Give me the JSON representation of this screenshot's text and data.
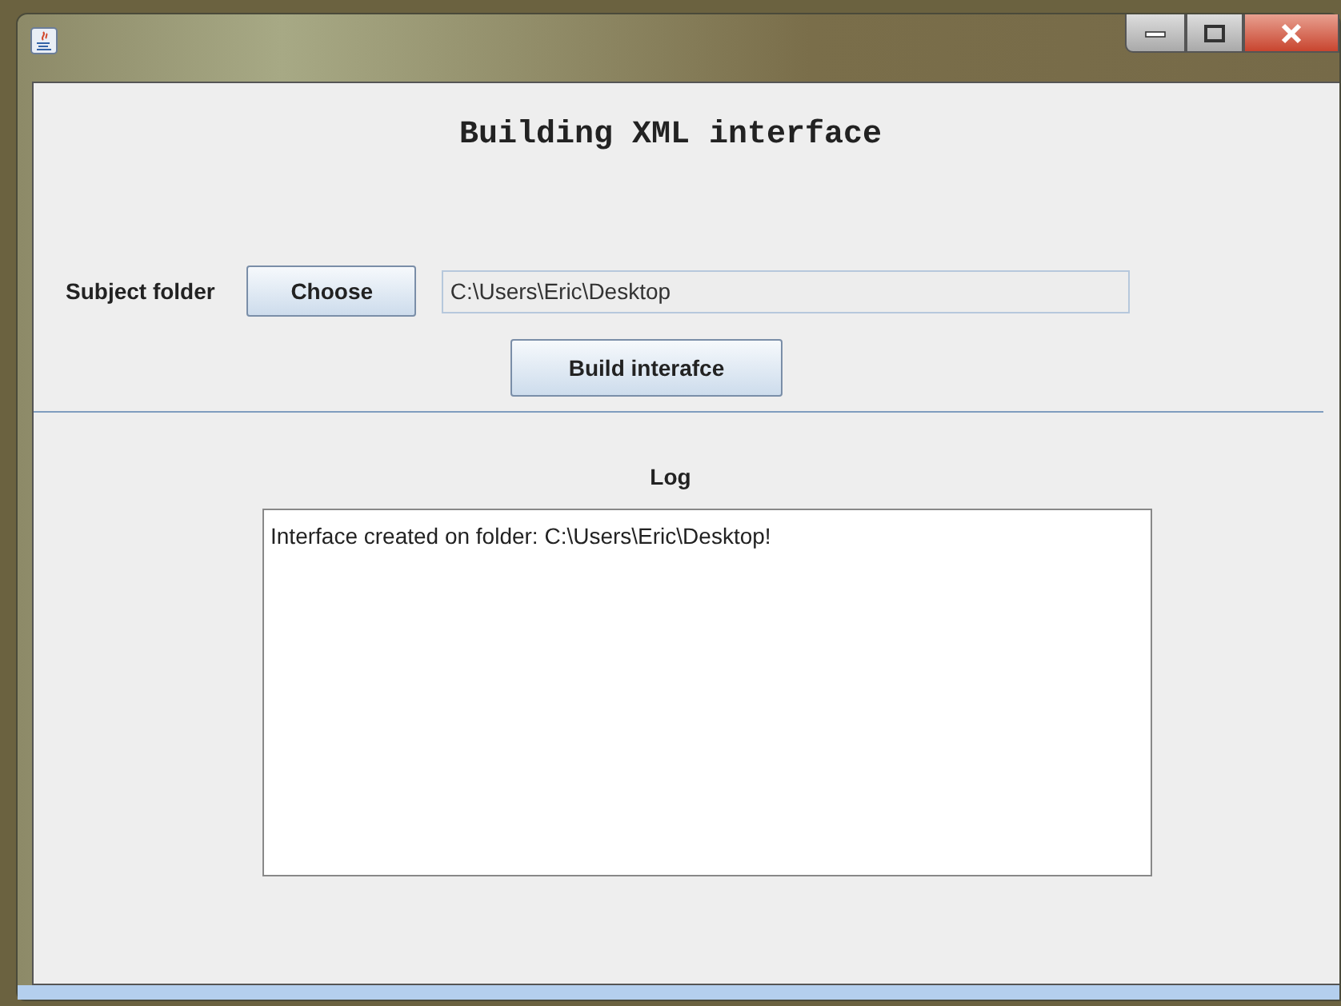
{
  "heading": "Building XML interface",
  "subject_folder": {
    "label": "Subject folder",
    "button": "Choose",
    "value": "C:\\Users\\Eric\\Desktop"
  },
  "build_button": "Build interafce",
  "log": {
    "label": "Log",
    "text": "Interface created on folder: C:\\Users\\Eric\\Desktop!"
  }
}
